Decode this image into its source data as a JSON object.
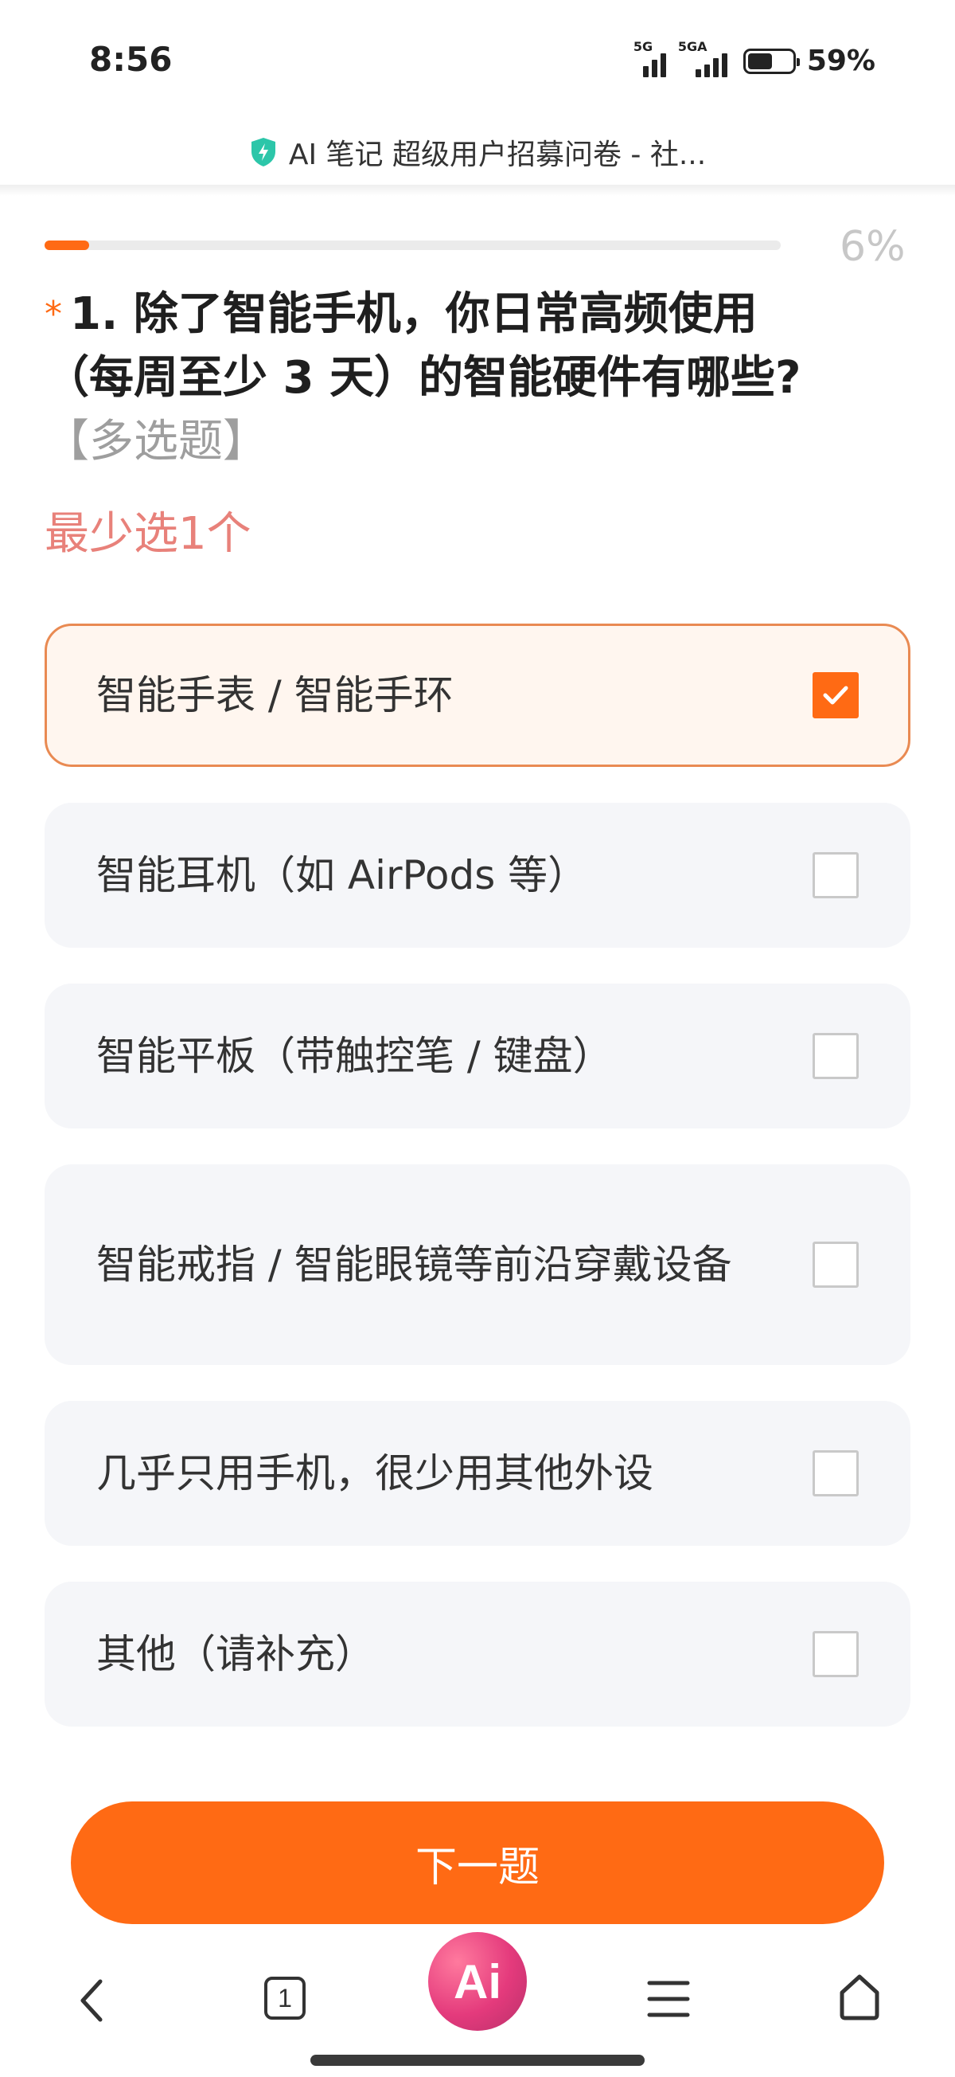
{
  "status_bar": {
    "time": "8:56",
    "signal1_label": "5G",
    "signal2_label": "5GA",
    "battery": "59%"
  },
  "browser": {
    "page_title": "AI 笔记 超级用户招募问卷 - 社..."
  },
  "progress": {
    "percent_text": "6%",
    "value": 0.06
  },
  "question": {
    "required_mark": "*",
    "text": "1. 除了智能手机，你日常高频使用（每周至少 3 天）的智能硬件有哪些?",
    "type_label": "【多选题】",
    "min_hint": "最少选1个"
  },
  "options": [
    {
      "label": "智能手表 / 智能手环",
      "checked": true
    },
    {
      "label": "智能耳机（如 AirPods 等）",
      "checked": false
    },
    {
      "label": "智能平板（带触控笔 / 键盘）",
      "checked": false
    },
    {
      "label": "智能戒指 / 智能眼镜等前沿穿戴设备",
      "checked": false
    },
    {
      "label": "几乎只用手机，很少用其他外设",
      "checked": false
    },
    {
      "label": "其他（请补充）",
      "checked": false
    }
  ],
  "next_button": "下一题",
  "bottom_nav": {
    "tab_count": "1",
    "ai_label": "Ai"
  },
  "colors": {
    "accent": "#ff6a14",
    "hint": "#e8817a",
    "option_bg": "#f5f6f9"
  }
}
